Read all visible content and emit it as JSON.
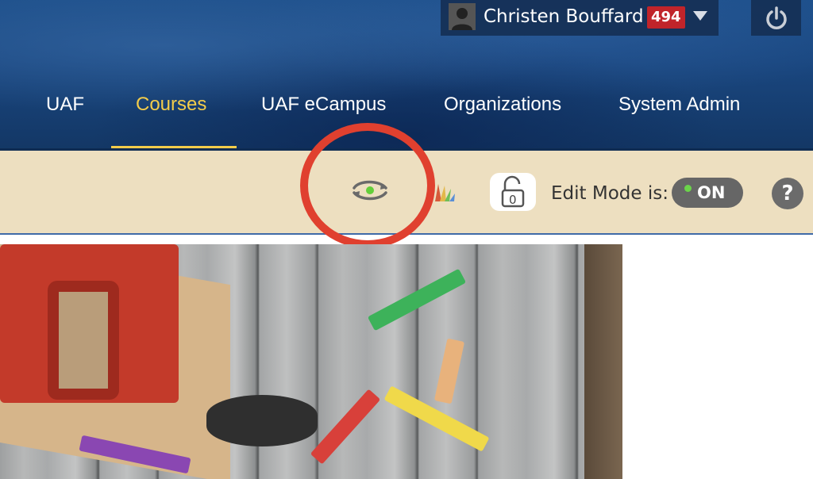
{
  "header": {
    "user": {
      "name": "Christen Bouffard",
      "notification_count": "494"
    },
    "nav": [
      {
        "label": "UAF"
      },
      {
        "label": "Courses",
        "active": true
      },
      {
        "label": "UAF eCampus"
      },
      {
        "label": "Organizations"
      },
      {
        "label": "System Admin"
      }
    ]
  },
  "toolbar": {
    "edit_mode_label": "Edit Mode is:",
    "edit_mode_value": "ON",
    "lock_count": "0",
    "help_label": "?"
  },
  "icons": {
    "preview": "eye-sync-icon",
    "theme": "color-palette-icon",
    "lock": "open-lock-icon",
    "power": "power-icon",
    "help": "help-icon"
  },
  "colors": {
    "header_bg": "#1a4780",
    "nav_active": "#f3cc4a",
    "toolbar_bg": "#eddfc0",
    "badge": "#c0242a",
    "toggle_on_dot": "#6bd44a",
    "highlight_ring": "#e0402f"
  }
}
